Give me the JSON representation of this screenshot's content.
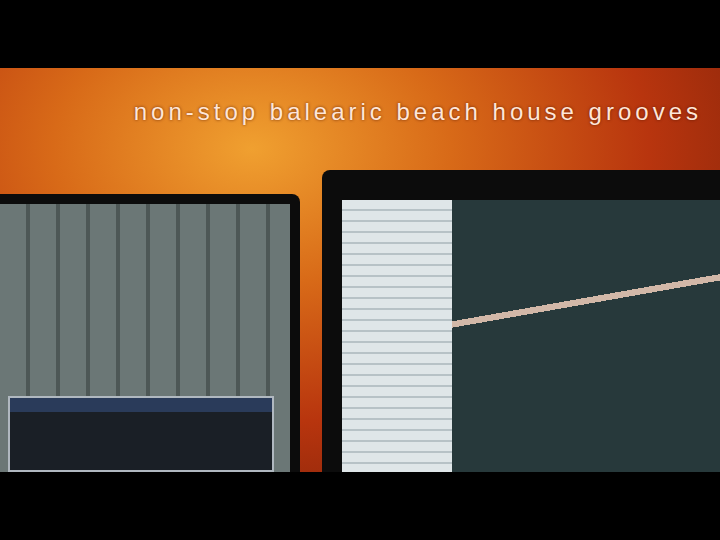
{
  "title": "non-stop balearic beach house grooves"
}
